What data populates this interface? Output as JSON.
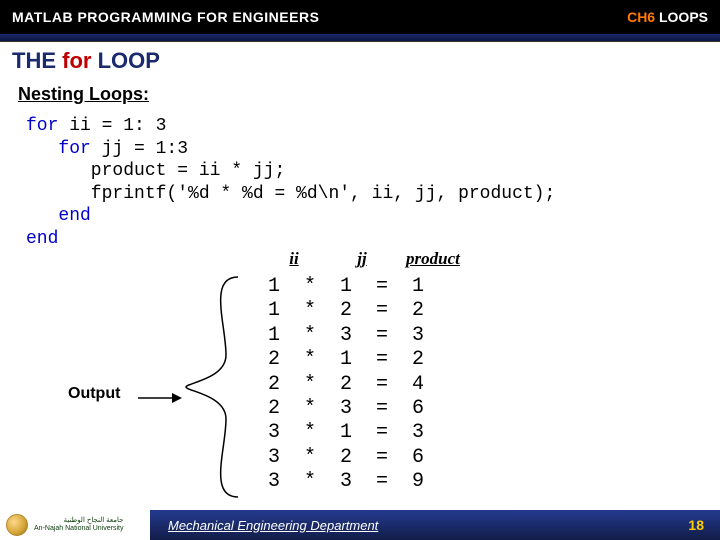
{
  "topbar": {
    "left": "MATLAB PROGRAMMING FOR ENGINEERS",
    "ch": "CH6",
    "right": " LOOPS"
  },
  "title": {
    "pre": "THE ",
    "for": "for",
    "post": " LOOP"
  },
  "subtitle": "Nesting Loops:",
  "code": {
    "l1a": "for",
    "l1b": " ii = 1: 3",
    "l2a": "   for",
    "l2b": " jj = 1:3",
    "l3": "      product = ii * jj;",
    "l4": "      fprintf('%d * %d = %d\\n', ii, jj, product);",
    "l5": "   end",
    "l6": "end"
  },
  "headers": {
    "ii": "ii",
    "jj": "jj",
    "product": "product"
  },
  "output_label": "Output",
  "rows": [
    "1  *  1  =  1",
    "1  *  2  =  2",
    "1  *  3  =  3",
    "2  *  1  =  2",
    "2  *  2  =  4",
    "2  *  3  =  6",
    "3  *  1  =  3",
    "3  *  2  =  6",
    "3  *  3  =  9"
  ],
  "footer": {
    "uni_ar": "جامعة النجاح الوطنية",
    "uni_en": "An-Najah National University",
    "dept": "Mechanical Engineering Department",
    "page": "18"
  },
  "chart_data": {
    "type": "table",
    "title": "Nested for-loop output (ii * jj = product)",
    "columns": [
      "ii",
      "jj",
      "product"
    ],
    "rows": [
      [
        1,
        1,
        1
      ],
      [
        1,
        2,
        2
      ],
      [
        1,
        3,
        3
      ],
      [
        2,
        1,
        2
      ],
      [
        2,
        2,
        4
      ],
      [
        2,
        3,
        6
      ],
      [
        3,
        1,
        3
      ],
      [
        3,
        2,
        6
      ],
      [
        3,
        3,
        9
      ]
    ]
  }
}
